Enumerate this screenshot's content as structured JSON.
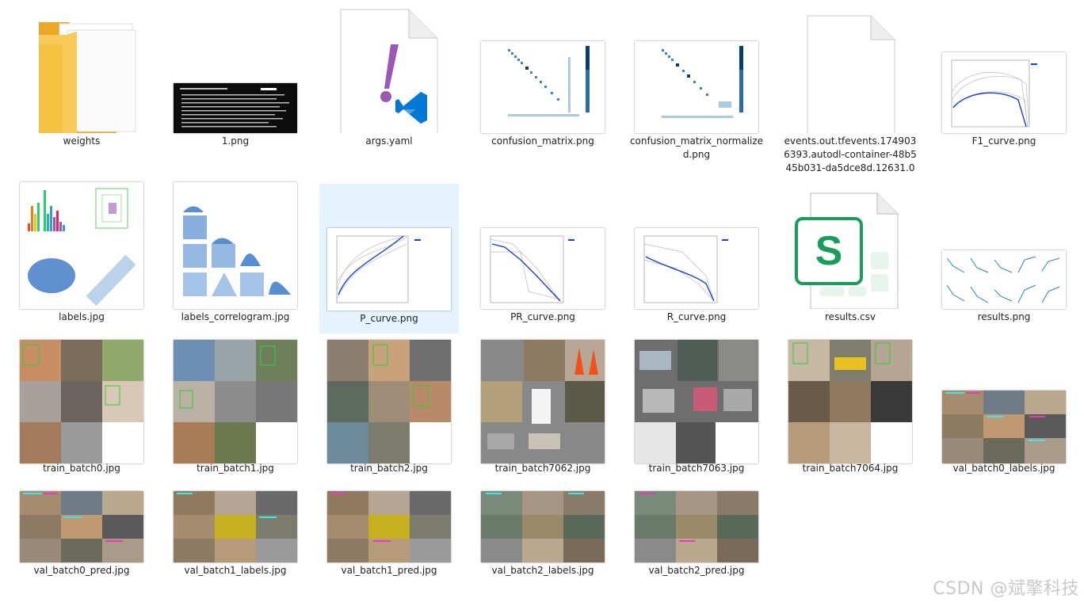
{
  "files": [
    {
      "name": "weights",
      "type": "folder-icon"
    },
    {
      "name": "1.png",
      "type": "terminal-image"
    },
    {
      "name": "args.yaml",
      "type": "yaml-vscode-icon"
    },
    {
      "name": "confusion_matrix.png",
      "type": "matrix-image"
    },
    {
      "name": "confusion_matrix_normalized.png",
      "type": "matrix-image"
    },
    {
      "name": "events.out.tfevents.1749036393.autodl-container-48b545b031-da5dce8d.12631.0",
      "type": "blank-file-icon"
    },
    {
      "name": "F1_curve.png",
      "type": "curve-image"
    },
    {
      "name": "labels.jpg",
      "type": "labels-image"
    },
    {
      "name": "labels_correlogram.jpg",
      "type": "correlogram-image"
    },
    {
      "name": "P_curve.png",
      "type": "curve-image"
    },
    {
      "name": "PR_curve.png",
      "type": "curve-image"
    },
    {
      "name": "R_curve.png",
      "type": "curve-image"
    },
    {
      "name": "results.csv",
      "type": "spreadsheet-icon"
    },
    {
      "name": "results.png",
      "type": "results-image"
    },
    {
      "name": "train_batch0.jpg",
      "type": "photo-mosaic"
    },
    {
      "name": "train_batch1.jpg",
      "type": "photo-mosaic"
    },
    {
      "name": "train_batch2.jpg",
      "type": "photo-mosaic"
    },
    {
      "name": "train_batch7062.jpg",
      "type": "photo-mosaic"
    },
    {
      "name": "train_batch7063.jpg",
      "type": "photo-mosaic"
    },
    {
      "name": "train_batch7064.jpg",
      "type": "photo-mosaic"
    },
    {
      "name": "val_batch0_labels.jpg",
      "type": "photo-mosaic"
    },
    {
      "name": "val_batch0_pred.jpg",
      "type": "photo-mosaic"
    },
    {
      "name": "val_batch1_labels.jpg",
      "type": "photo-mosaic"
    },
    {
      "name": "val_batch1_pred.jpg",
      "type": "photo-mosaic"
    },
    {
      "name": "val_batch2_labels.jpg",
      "type": "photo-mosaic"
    },
    {
      "name": "val_batch2_pred.jpg",
      "type": "photo-mosaic"
    }
  ],
  "selected": "P_curve.png",
  "watermark": "CSDN @斌擎科技",
  "colors": {
    "selection": "#e5f3ff",
    "folder": "#f5c242",
    "yaml_mark": "#9b59b6",
    "vscode": "#0078d4",
    "sheet": "#1a9c5b"
  }
}
